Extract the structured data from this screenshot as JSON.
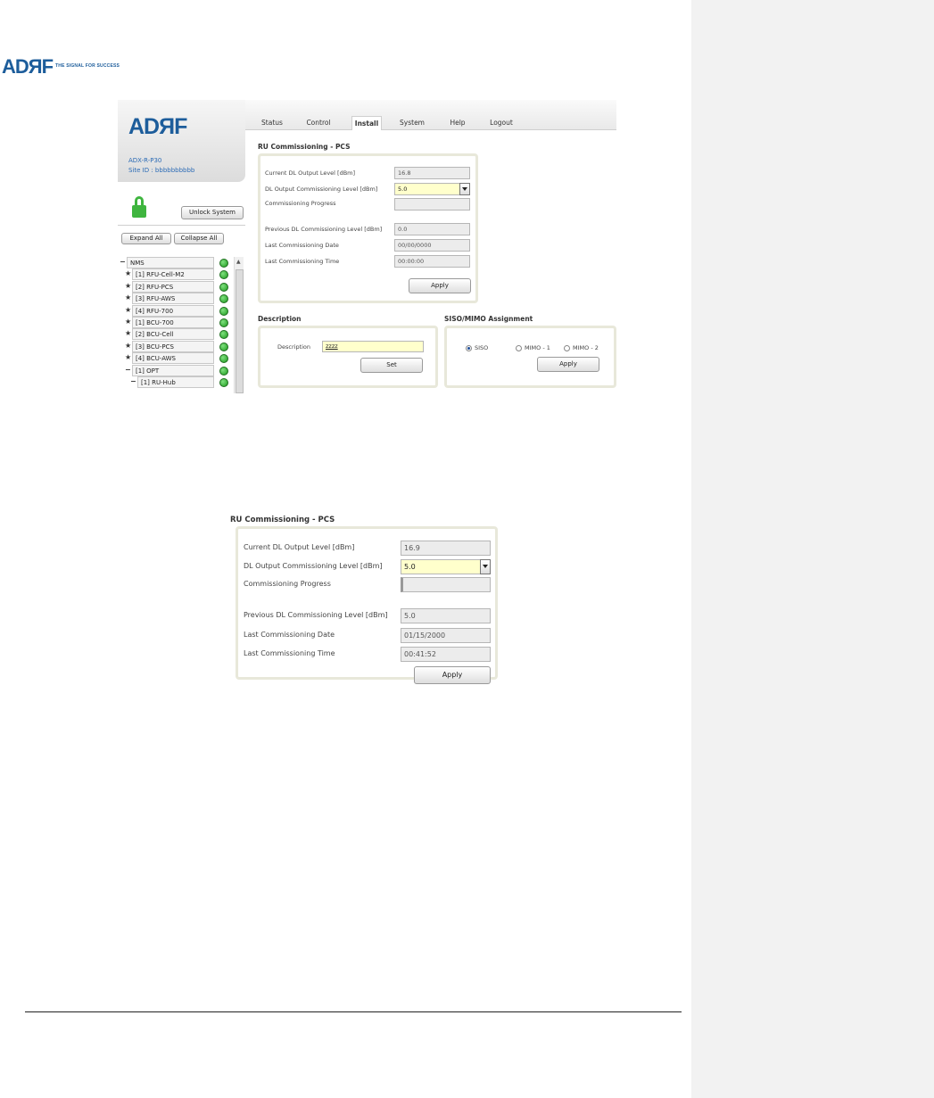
{
  "page": {
    "logo_text": "ADЯF",
    "tagline": "THE SIGNAL FOR SUCCESS"
  },
  "app": {
    "logo_text": "ADЯF",
    "model": "ADX-R-P30",
    "site_id": "Site ID : bbbbbbbbbb",
    "tabs": [
      "Status",
      "Control",
      "Install",
      "System",
      "Help",
      "Logout"
    ],
    "active_tab": "Install",
    "unlock_button": "Unlock System",
    "expand_all": "Expand All",
    "collapse_all": "Collapse All",
    "tree": [
      {
        "sym": "−",
        "label": "NMS"
      },
      {
        "sym": "★",
        "label": "[1] RFU-Cell-M2"
      },
      {
        "sym": "★",
        "label": "[2] RFU-PCS"
      },
      {
        "sym": "★",
        "label": "[3] RFU-AWS"
      },
      {
        "sym": "★",
        "label": "[4] RFU-700"
      },
      {
        "sym": "★",
        "label": "[1] BCU-700"
      },
      {
        "sym": "★",
        "label": "[2] BCU-Cell"
      },
      {
        "sym": "★",
        "label": "[3] BCU-PCS"
      },
      {
        "sym": "★",
        "label": "[4] BCU-AWS"
      },
      {
        "sym": "−",
        "label": "[1] OPT"
      },
      {
        "sym": "−",
        "label": "[1] RU-Hub"
      }
    ],
    "commissioning": {
      "title": "RU Commissioning - PCS",
      "current_dl_label": "Current DL Output Level [dBm]",
      "current_dl_value": "16.8",
      "dl_commission_label": "DL Output Commissioning Level [dBm]",
      "dl_commission_value": "5.0",
      "progress_label": "Commissioning Progress",
      "prev_dl_label": "Previous DL Commissioning Level [dBm]",
      "prev_dl_value": "0.0",
      "last_date_label": "Last Commissioning Date",
      "last_date_value": "00/00/0000",
      "last_time_label": "Last Commissioning Time",
      "last_time_value": "00:00:00",
      "apply": "Apply"
    },
    "description": {
      "title": "Description",
      "label": "Description",
      "value": "zzzz",
      "set": "Set"
    },
    "siso": {
      "title": "SISO/MIMO Assignment",
      "options": [
        "SISO",
        "MIMO - 1",
        "MIMO - 2"
      ],
      "selected": "SISO",
      "apply": "Apply"
    }
  },
  "zoom_panel": {
    "title": "RU Commissioning - PCS",
    "current_dl_label": "Current DL Output Level [dBm]",
    "current_dl_value": "16.9",
    "dl_commission_label": "DL Output Commissioning Level [dBm]",
    "dl_commission_value": "5.0",
    "progress_label": "Commissioning Progress",
    "prev_dl_label": "Previous DL Commissioning Level [dBm]",
    "prev_dl_value": "5.0",
    "last_date_label": "Last Commissioning Date",
    "last_date_value": "01/15/2000",
    "last_time_label": "Last Commissioning Time",
    "last_time_value": "00:41:52",
    "apply": "Apply"
  }
}
